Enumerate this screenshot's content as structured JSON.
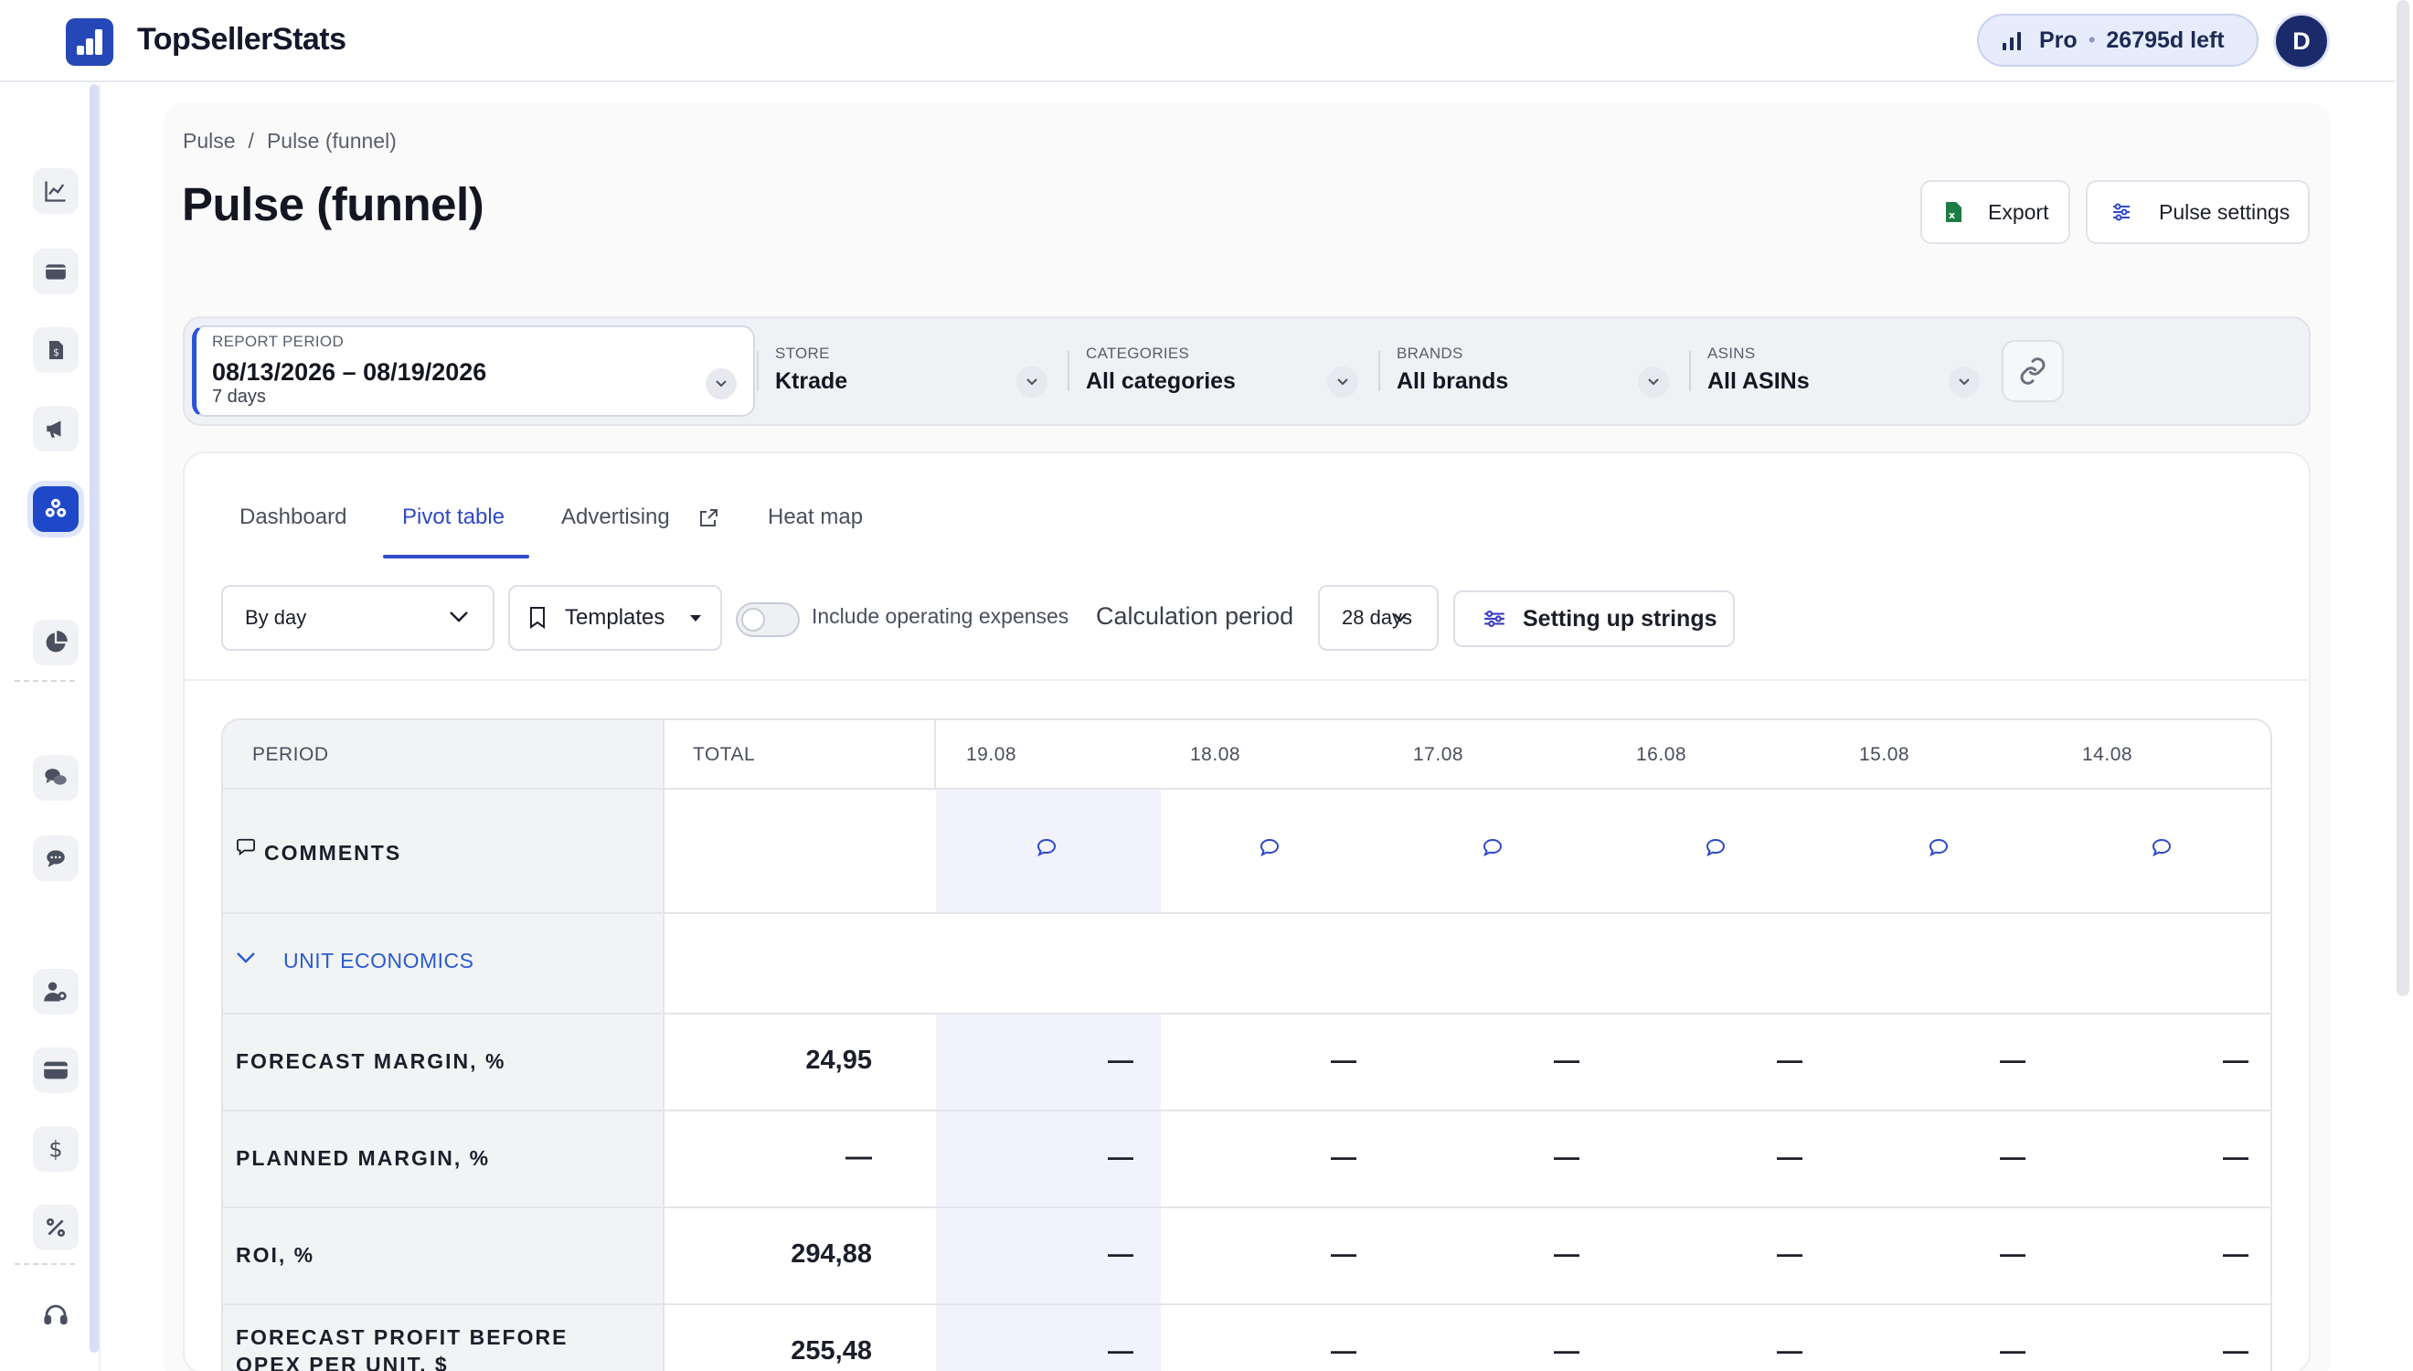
{
  "app": {
    "brand": "TopSellerStats",
    "plan": {
      "name": "Pro",
      "remaining": "26795d left"
    },
    "avatar_initial": "D"
  },
  "sidebar": {
    "items": [
      {
        "icon": "chart-line-icon",
        "active": false
      },
      {
        "icon": "wallet-icon",
        "active": false
      },
      {
        "icon": "invoice-icon",
        "active": false
      },
      {
        "icon": "megaphone-icon",
        "active": false
      },
      {
        "icon": "pulse-funnel-icon",
        "active": true
      },
      {
        "icon": "pie-chart-icon",
        "active": false
      },
      {
        "icon": "chat-bubbles-icon",
        "active": false
      },
      {
        "icon": "chat-dots-icon",
        "active": false
      },
      {
        "icon": "user-settings-icon",
        "active": false
      },
      {
        "icon": "credit-card-icon",
        "active": false
      },
      {
        "icon": "dollar-icon",
        "active": false
      },
      {
        "icon": "percent-icon",
        "active": false
      },
      {
        "icon": "headset-icon",
        "active": false
      }
    ]
  },
  "breadcrumb": {
    "root": "Pulse",
    "separator": "/",
    "current": "Pulse (funnel)"
  },
  "page": {
    "title": "Pulse (funnel)"
  },
  "actions": {
    "export": "Export",
    "settings": "Pulse settings"
  },
  "filters": {
    "period": {
      "label": "REPORT PERIOD",
      "value": "08/13/2026 – 08/19/2026",
      "sub": "7 days"
    },
    "store": {
      "label": "STORE",
      "value": "Ktrade"
    },
    "categories": {
      "label": "CATEGORIES",
      "value": "All categories"
    },
    "brands": {
      "label": "BRANDS",
      "value": "All brands"
    },
    "asins": {
      "label": "ASINS",
      "value": "All ASINs"
    }
  },
  "tabs": [
    {
      "label": "Dashboard",
      "active": false
    },
    {
      "label": "Pivot table",
      "active": true
    },
    {
      "label": "Advertising",
      "active": false,
      "external": true
    },
    {
      "label": "Heat map",
      "active": false
    }
  ],
  "toolbar": {
    "grouping": "By day",
    "templates": "Templates",
    "opex_toggle_label": "Include operating expenses",
    "opex_enabled": false,
    "calc_period_label": "Calculation period",
    "calc_period_value": "28 days",
    "strings_button": "Setting up strings"
  },
  "table": {
    "headers": {
      "period": "PERIOD",
      "total": "TOTAL"
    },
    "dates": [
      "19.08",
      "18.08",
      "17.08",
      "16.08",
      "15.08",
      "14.08"
    ],
    "comments_label": "COMMENTS",
    "section": "UNIT ECONOMICS",
    "rows": [
      {
        "label": "FORECAST MARGIN, %",
        "total": "24,95",
        "values": [
          "—",
          "—",
          "—",
          "—",
          "—",
          "—"
        ]
      },
      {
        "label": "PLANNED MARGIN, %",
        "total": "—",
        "values": [
          "—",
          "—",
          "—",
          "—",
          "—",
          "—"
        ]
      },
      {
        "label": "ROI, %",
        "total": "294,88",
        "values": [
          "—",
          "—",
          "—",
          "—",
          "—",
          "—"
        ]
      },
      {
        "label": "FORECAST PROFIT BEFORE OPEX PER UNIT, $",
        "total": "255,48",
        "values": [
          "—",
          "—",
          "—",
          "—",
          "—",
          "—"
        ]
      }
    ]
  },
  "colors": {
    "accent": "#2e49c9",
    "brand": "#2547b8",
    "highlight_col": "#f2f2fc"
  }
}
